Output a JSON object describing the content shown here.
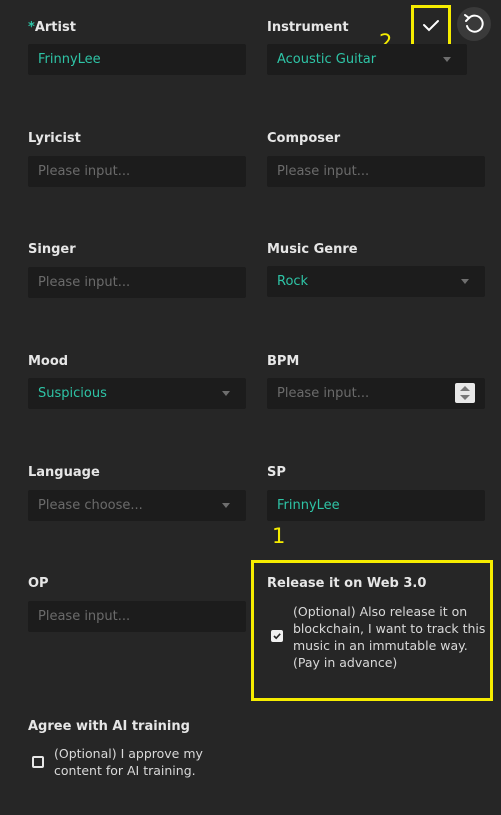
{
  "toolbar": {
    "confirm_icon": "checkmark-icon",
    "reset_icon": "reset-icon"
  },
  "annotations": {
    "one": "1",
    "two": "2"
  },
  "fields": {
    "artist": {
      "required_mark": "*",
      "label": "Artist",
      "value": "FrinnyLee"
    },
    "instrument": {
      "label": "Instrument",
      "value": "Acoustic Guitar"
    },
    "lyricist": {
      "label": "Lyricist",
      "placeholder": "Please input..."
    },
    "composer": {
      "label": "Composer",
      "placeholder": "Please input..."
    },
    "singer": {
      "label": "Singer",
      "placeholder": "Please input..."
    },
    "genre": {
      "label": "Music Genre",
      "value": "Rock"
    },
    "mood": {
      "label": "Mood",
      "value": "Suspicious"
    },
    "bpm": {
      "label": "BPM",
      "placeholder": "Please input..."
    },
    "language": {
      "label": "Language",
      "placeholder": "Please choose..."
    },
    "sp": {
      "label": "SP",
      "value": "FrinnyLee"
    },
    "op": {
      "label": "OP",
      "placeholder": "Please input..."
    }
  },
  "web3": {
    "label": "Release it on Web 3.0",
    "checked": true,
    "text": "(Optional) Also release it on blockchain, I want to track this music in an immutable way. (Pay in advance)"
  },
  "ai": {
    "label": "Agree with AI training",
    "checked": false,
    "text": "(Optional) I approve my content for AI training."
  }
}
